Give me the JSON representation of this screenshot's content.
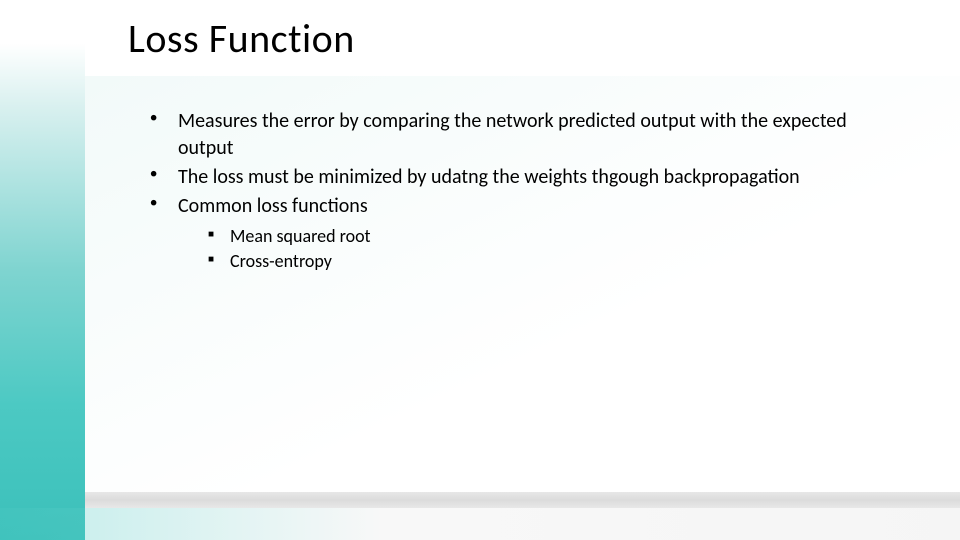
{
  "slide": {
    "title": "Loss Function",
    "bullets": [
      {
        "text": "Measures the error by comparing the network predicted output with the expected output"
      },
      {
        "text": "The loss must be minimized by udatng the weights thgough backpropagation"
      },
      {
        "text": "Common loss functions"
      }
    ],
    "subBullets": [
      {
        "text": "Mean squared root"
      },
      {
        "text": "Cross-entropy"
      }
    ]
  }
}
